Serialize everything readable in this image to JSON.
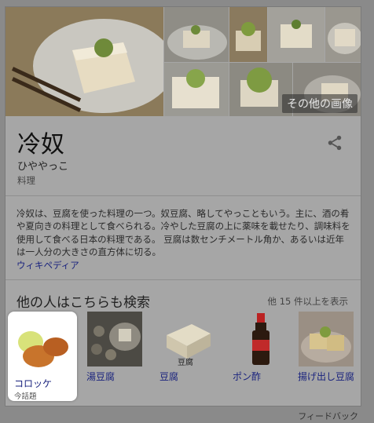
{
  "gallery": {
    "more_photos_label": "その他の画像"
  },
  "entity": {
    "title": "冷奴",
    "reading": "ひややっこ",
    "category": "料理"
  },
  "description": {
    "text": "冷奴は、豆腐を使った料理の一つ。奴豆腐、略してやっこともいう。主に、酒の肴や夏向きの料理として食べられる。冷やした豆腐の上に薬味を載せたり、調味料を使用して食べる日本の料理である。 豆腐は数センチメートル角か、あるいは近年は一人分の大きさの直方体に切る。",
    "source_link": "ウィキペディア"
  },
  "related": {
    "heading": "他の人はこちらも検索",
    "more_label": "他 15 件以上を表示",
    "items": [
      {
        "label": "コロッケ",
        "sublabel": "今話題",
        "icon": "croquette-image"
      },
      {
        "label": "湯豆腐",
        "sublabel": "",
        "icon": "yudofu-image"
      },
      {
        "label": "豆腐",
        "sublabel": "",
        "icon": "tofu-image"
      },
      {
        "label": "ポン酢",
        "sublabel": "",
        "icon": "ponzu-bottle-image"
      },
      {
        "label": "揚げ出し豆腐",
        "sublabel": "",
        "icon": "agedashi-tofu-image"
      }
    ]
  },
  "footer": {
    "feedback_label": "フィードバック"
  },
  "colors": {
    "overlay": "#8a8a8a",
    "card": "#a6a6a6",
    "link": "#1a237e",
    "highlight": "#ffffff"
  },
  "icons": {
    "share": "share-icon"
  }
}
